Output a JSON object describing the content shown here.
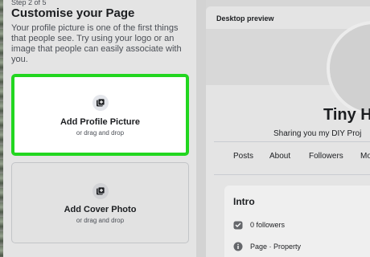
{
  "setup": {
    "step": "Step 2 of 5",
    "title": "Customise your Page",
    "description": "Your profile picture is one of the first things that people see. Try using your logo or an image that people can easily associate with you."
  },
  "profile_upload": {
    "title": "Add Profile Picture",
    "hint": "or drag and drop",
    "icon": "add-photo-icon",
    "highlight_color": "#22d61f"
  },
  "cover_upload": {
    "title": "Add Cover Photo",
    "hint": "or drag and drop",
    "icon": "add-photo-icon"
  },
  "preview": {
    "label": "Desktop preview",
    "page_name": "Tiny H",
    "page_description": "Sharing you my DIY Proj",
    "tabs": [
      "Posts",
      "About",
      "Followers",
      "Mo"
    ],
    "intro": {
      "title": "Intro",
      "followers": "0 followers",
      "category": "Page · Property"
    }
  }
}
